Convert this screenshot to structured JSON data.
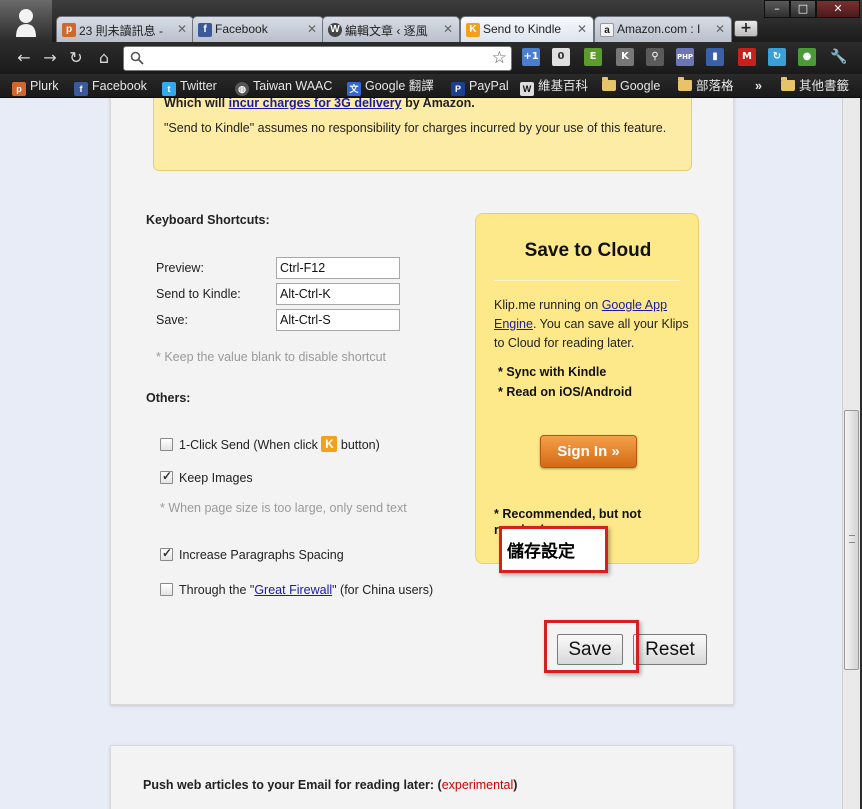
{
  "tabs": [
    {
      "title": "23 則未讀訊息 -",
      "icon": "plurk-icon",
      "color": "#cf682f",
      "glyph": "p"
    },
    {
      "title": "Facebook",
      "icon": "facebook-icon",
      "color": "#3b5998",
      "glyph": "f"
    },
    {
      "title": "編輯文章 ‹ 逐風",
      "icon": "wordpress-icon",
      "color": "#464646",
      "glyph": "W"
    },
    {
      "title": "Send to Kindle",
      "icon": "kindle-k-icon",
      "color": "#f2a11b",
      "glyph": "K"
    },
    {
      "title": "Amazon.com : I",
      "icon": "amazon-icon",
      "color": "#222222",
      "glyph": "a"
    }
  ],
  "new_tab_symbol": "+",
  "window_controls": {
    "minimize": "–",
    "maximize": "□",
    "close": "✕"
  },
  "omnibox": {
    "value": "",
    "placeholder": ""
  },
  "extensions": [
    {
      "icon": "extension-plus-one-icon",
      "glyph": "+1",
      "color": "#4a7fcf"
    },
    {
      "icon": "extension-counter-icon",
      "glyph": "0",
      "color": "#8e8e8e"
    },
    {
      "icon": "extension-evernote-icon",
      "glyph": "E",
      "color": "#5c9c2a"
    },
    {
      "icon": "extension-klip-k-icon",
      "glyph": "K",
      "color": "#777777"
    },
    {
      "icon": "extension-pin-icon",
      "glyph": "⚲",
      "color": "#5a5a5a"
    },
    {
      "icon": "extension-php-icon",
      "glyph": "PHP",
      "color": "#6a76b5"
    },
    {
      "icon": "extension-stats-icon",
      "glyph": "▮",
      "color": "#3a61a8"
    },
    {
      "icon": "extension-gmail-icon",
      "glyph": "M",
      "color": "#c7211c"
    },
    {
      "icon": "extension-sync-icon",
      "glyph": "↻",
      "color": "#3aa0d8"
    },
    {
      "icon": "extension-green-icon",
      "glyph": "●",
      "color": "#4a9a3a"
    }
  ],
  "bookmarks": [
    {
      "label": "Plurk",
      "icon": "plurk-icon",
      "color": "#cf682f",
      "glyph": "p"
    },
    {
      "label": "Facebook",
      "icon": "facebook-icon",
      "color": "#3b5998",
      "glyph": "f"
    },
    {
      "label": "Twitter",
      "icon": "twitter-icon",
      "color": "#33aaee",
      "glyph": "t"
    },
    {
      "label": "Taiwan WAAC",
      "icon": "globe-icon",
      "color": "#555555",
      "glyph": "◍"
    },
    {
      "label": "Google 翻譯",
      "icon": "google-translate-icon",
      "color": "#3367d6",
      "glyph": "文"
    },
    {
      "label": "PayPal",
      "icon": "paypal-icon",
      "color": "#1d3f8f",
      "glyph": "P"
    },
    {
      "label": "維基百科",
      "icon": "wikipedia-icon",
      "color": "#dddddd",
      "glyph": "W"
    },
    {
      "label": "Google",
      "icon": "folder-icon",
      "color": "",
      "glyph": ""
    },
    {
      "label": "部落格",
      "icon": "folder-icon",
      "color": "",
      "glyph": ""
    }
  ],
  "bookmarks_overflow": "»",
  "other_bookmarks": "其他書籤",
  "notice": {
    "line1_prefix": "Which will ",
    "line1_link": "incur charges for 3G delivery",
    "line1_suffix": " by Amazon.",
    "line2": "\"Send to Kindle\" assumes no responsibility for charges incurred by your use of this feature."
  },
  "shortcuts": {
    "title": "Keyboard Shortcuts:",
    "rows": [
      {
        "label": "Preview:",
        "value": "Ctrl-F12"
      },
      {
        "label": "Send to Kindle:",
        "value": "Alt-Ctrl-K"
      },
      {
        "label": "Save:",
        "value": "Alt-Ctrl-S"
      }
    ],
    "hint": "* Keep the value blank to disable shortcut"
  },
  "others": {
    "title": "Others:",
    "one_click": {
      "prefix": "1-Click Send (When click ",
      "suffix": " button)",
      "checked": false
    },
    "keep_images": {
      "label": "Keep Images",
      "checked": true
    },
    "keep_images_hint": "* When page size is too large, only send text",
    "paragraph_spacing": {
      "label": "Increase Paragraphs Spacing",
      "checked": true
    },
    "firewall": {
      "prefix": "Through the \"",
      "link": "Great Firewall",
      "suffix": "\" (for China users)",
      "checked": false
    }
  },
  "cloud": {
    "title": "Save to Cloud",
    "desc_prefix": "Klip.me running on ",
    "desc_link": "Google App Engine",
    "desc_suffix": ". You can save all your Klips to Cloud for reading later.",
    "features": [
      "* Sync with Kindle",
      "* Read on iOS/Android"
    ],
    "sign_in": "Sign In »",
    "recommend": "* Recommended, but not required."
  },
  "callout_text": "儲存設定",
  "buttons": {
    "save": "Save",
    "reset": "Reset"
  },
  "email": {
    "title": "Push web articles to your Email for reading later: (",
    "experimental": "experimental",
    "close_paren": ")"
  }
}
